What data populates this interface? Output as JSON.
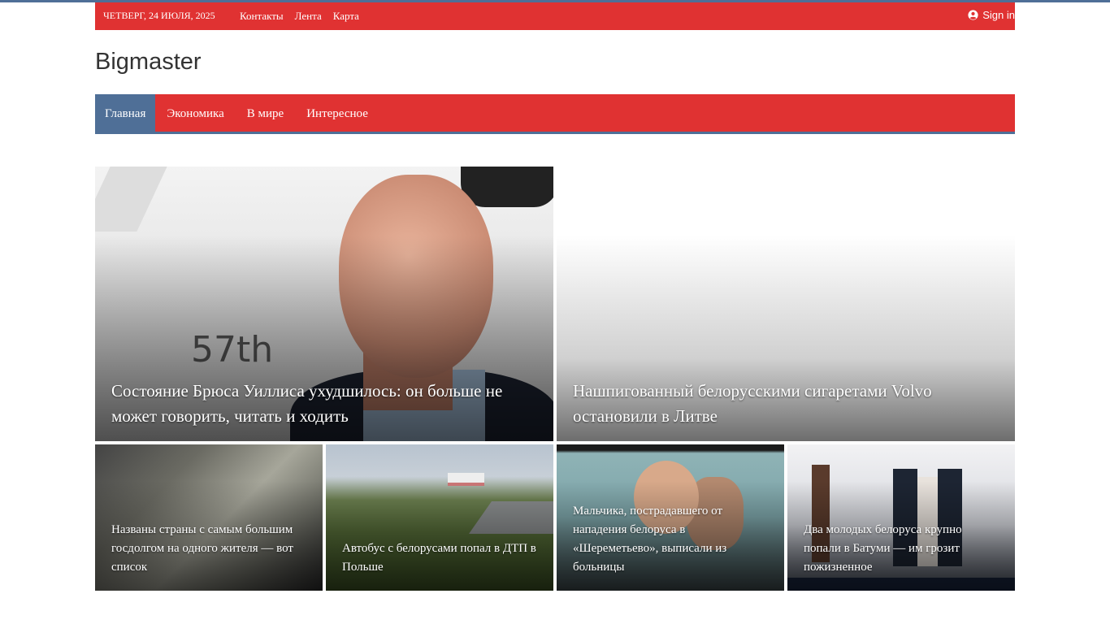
{
  "topbar": {
    "date": "ЧЕТВЕРГ, 24 ИЮЛЯ, 2025",
    "links": [
      "Контакты",
      "Лента",
      "Карта"
    ],
    "signin": "Sign in"
  },
  "site": {
    "logo": "Bigmaster"
  },
  "nav": {
    "items": [
      "Главная",
      "Экономика",
      "В мире",
      "Интересное"
    ],
    "active": "Главная"
  },
  "colors": {
    "brand_red": "#e03232",
    "accent_blue": "#4f6f97"
  },
  "featured": {
    "big": [
      {
        "title": "Состояние Брюса Уиллиса ухудшилось: он больше не может говорить, читать и ходить"
      },
      {
        "title": "Нашпигованный белорусскими сигаретами Volvo остановили в Литве"
      }
    ],
    "small": [
      {
        "title": "Названы страны с самым большим госдолгом на одного жителя — вот список"
      },
      {
        "title": "Автобус с белорусами попал в ДТП в Польше"
      },
      {
        "title": "Мальчика, пострадавшего от нападения белоруса в «Шереметьево», выписали из больницы"
      },
      {
        "title": "Два молодых белоруса крупно попали в Батуми — им грозит пожизненное"
      }
    ]
  }
}
